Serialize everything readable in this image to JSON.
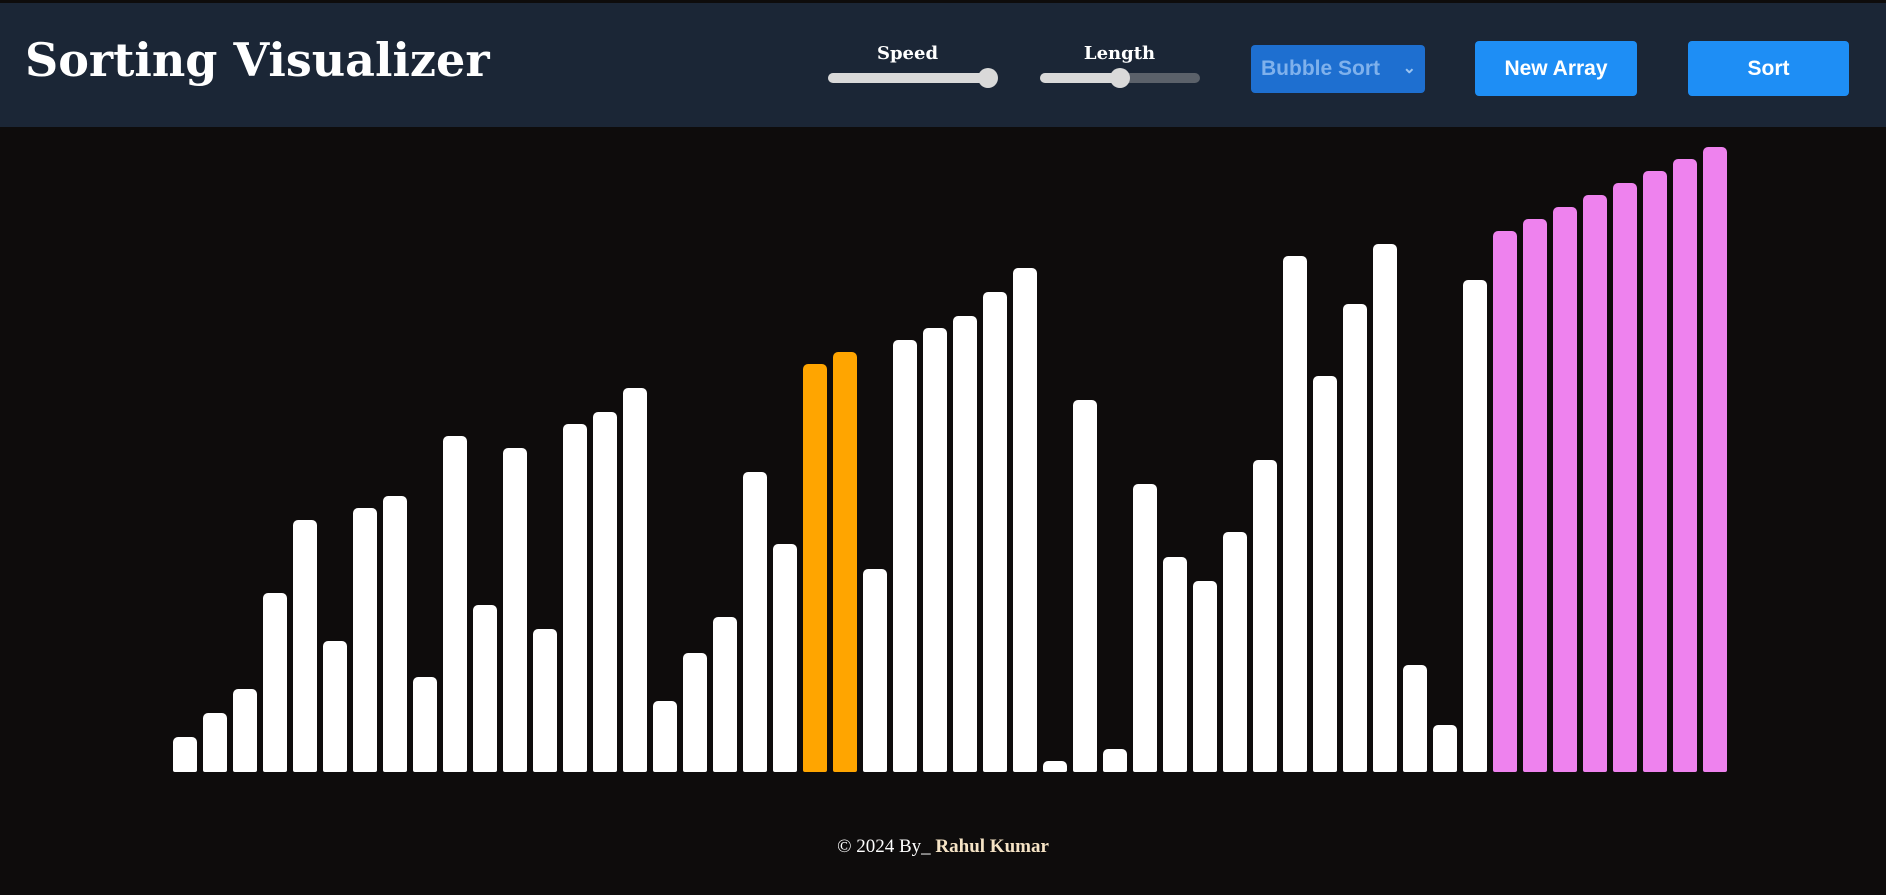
{
  "header": {
    "title": "Sorting Visualizer",
    "speed": {
      "label": "Speed",
      "value": 1.0
    },
    "length": {
      "label": "Length",
      "value": 0.5
    },
    "algorithm": {
      "selected": "Bubble Sort"
    },
    "new_array_label": "New Array",
    "sort_label": "Sort"
  },
  "colors": {
    "header_bg": "#1b2636",
    "page_bg": "#0e0c0c",
    "bar_default": "#ffffff",
    "bar_compare": "#ffa500",
    "bar_sorted": "#ee82ee",
    "button": "#1e8ef5"
  },
  "bars": {
    "values": [
      29,
      49,
      69,
      149,
      209,
      109,
      219,
      229,
      79,
      279,
      139,
      269,
      119,
      289,
      299,
      319,
      59,
      99,
      129,
      249,
      189,
      339,
      349,
      169,
      359,
      369,
      379,
      399,
      419,
      9,
      309,
      19,
      239,
      179,
      159,
      199,
      259,
      429,
      329,
      389,
      439,
      89,
      39,
      409,
      449,
      459,
      469,
      479,
      489,
      499,
      509,
      519
    ],
    "states": {
      "compare_indices": [
        21,
        22
      ],
      "sorted_from_index": 44
    }
  },
  "footer": {
    "prefix": "© 2024 By_ ",
    "author": "Rahul Kumar"
  }
}
